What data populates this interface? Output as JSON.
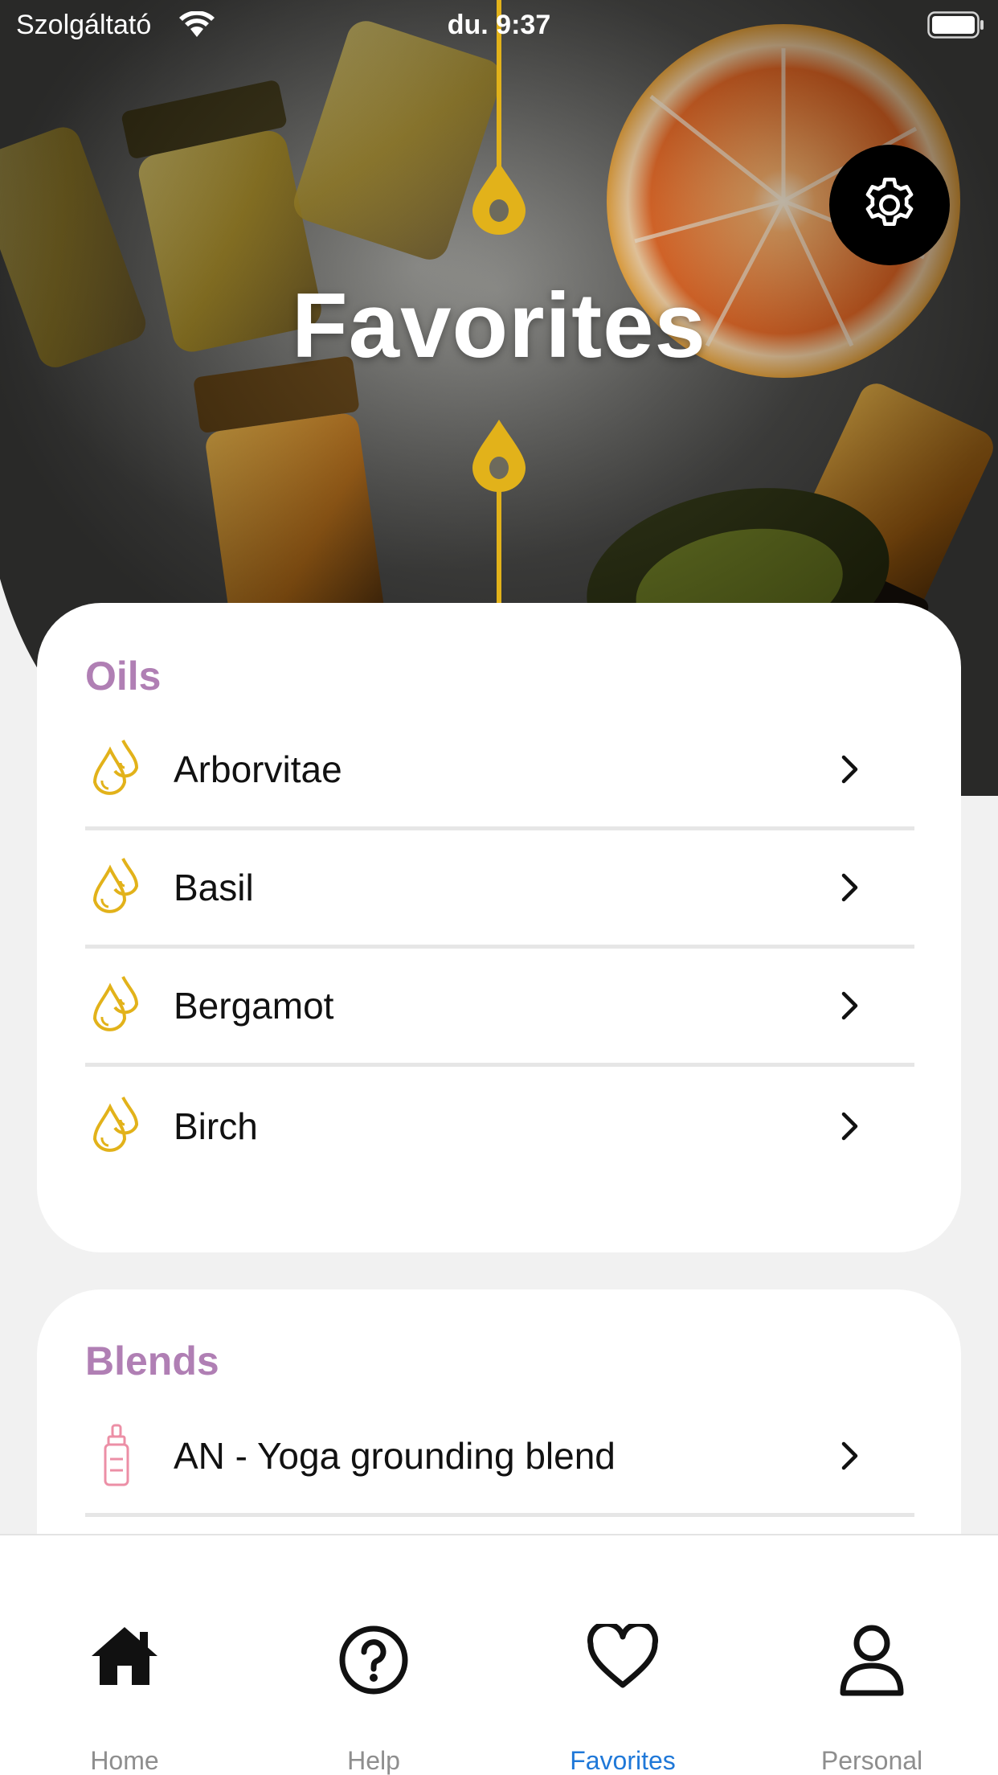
{
  "status_bar": {
    "carrier": "Szolgáltató",
    "time": "du. 9:37"
  },
  "header": {
    "title": "Favorites"
  },
  "colors": {
    "accent_gold": "#e2b21a",
    "section_title": "#b07fb4",
    "tab_active": "#1f78d8",
    "tab_inactive": "#8e8e8e",
    "blend_icon": "#ec8fa6"
  },
  "oils": {
    "title": "Oils",
    "icon": "oil-drops-icon",
    "items": [
      {
        "label": "Arborvitae"
      },
      {
        "label": "Basil"
      },
      {
        "label": "Bergamot"
      },
      {
        "label": "Birch"
      }
    ]
  },
  "blends": {
    "title": "Blends",
    "icon": "dropper-bottle-icon",
    "items": [
      {
        "label": "AN - Yoga grounding blend"
      }
    ]
  },
  "tab_bar": {
    "active": "favorites",
    "tabs": [
      {
        "id": "home",
        "label": "Home",
        "icon": "home-icon"
      },
      {
        "id": "help",
        "label": "Help",
        "icon": "help-icon"
      },
      {
        "id": "favorites",
        "label": "Favorites",
        "icon": "heart-icon"
      },
      {
        "id": "personal",
        "label": "Personal",
        "icon": "person-icon"
      }
    ]
  }
}
